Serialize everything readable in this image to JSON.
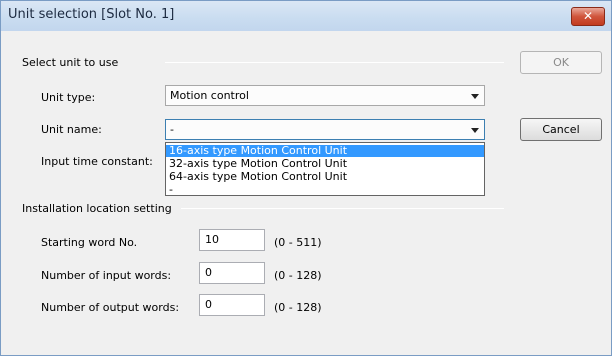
{
  "window": {
    "title": "Unit selection [Slot No. 1]",
    "close_glyph": "✕"
  },
  "select_unit": {
    "heading": "Select unit to use",
    "unit_type_label": "Unit type:",
    "unit_type_value": "Motion control",
    "unit_name_label": "Unit name:",
    "unit_name_value": "-",
    "input_time_label": "Input time constant:"
  },
  "dropdown": {
    "items": [
      "16-axis type Motion Control Unit",
      "32-axis type Motion Control Unit",
      "64-axis type Motion Control Unit",
      "-"
    ],
    "selected_index": 0
  },
  "buttons": {
    "ok": "OK",
    "cancel": "Cancel"
  },
  "installation": {
    "heading": "Installation location setting",
    "rows": [
      {
        "label": "Starting word No.",
        "value": "10",
        "range": "(0 - 511)"
      },
      {
        "label": "Number of input words:",
        "value": "0",
        "range": "(0 - 128)"
      },
      {
        "label": "Number of output words:",
        "value": "0",
        "range": "(0 - 128)"
      }
    ]
  }
}
